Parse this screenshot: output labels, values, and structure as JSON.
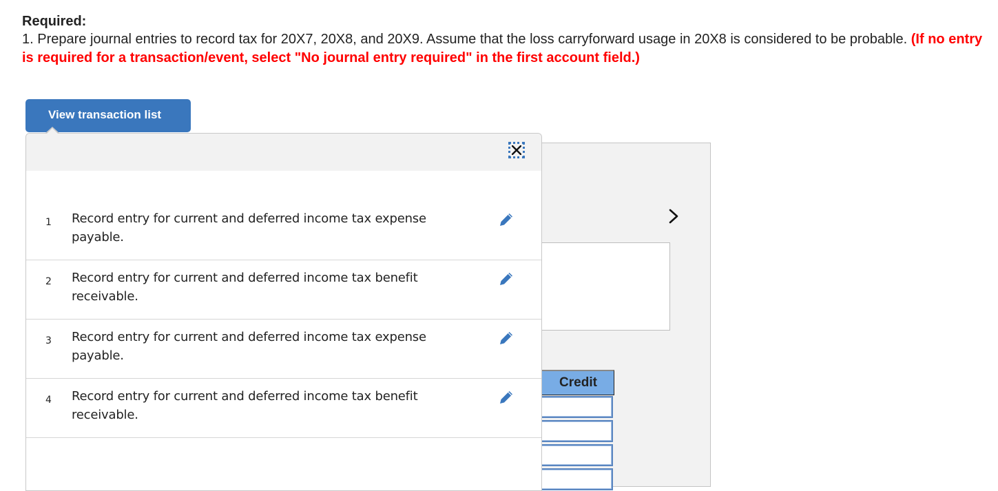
{
  "question": {
    "heading": "Required:",
    "instruction_text": "1. Prepare journal entries to record tax for 20X7, 20X8, and 20X9. Assume that the loss carryforward usage in 20X8 is considered to be probable. ",
    "instruction_note": "(If no entry is required for a transaction/event, select \"No journal entry required\" in the first account field.)"
  },
  "view_transaction_list_button": "View transaction list",
  "transaction_popover": {
    "close_icon": "close-icon",
    "edit_icon": "pencil-icon",
    "items": [
      {
        "number": "1",
        "description": "Record entry for current and deferred income tax expense payable."
      },
      {
        "number": "2",
        "description": "Record entry for current and deferred income tax benefit receivable."
      },
      {
        "number": "3",
        "description": "Record entry for current and deferred income tax expense payable."
      },
      {
        "number": "4",
        "description": "Record entry for current and deferred income tax benefit receivable."
      }
    ]
  },
  "worksheet": {
    "next_icon": "chevron-right-icon",
    "credit_header": "Credit",
    "credit_cells": [
      "",
      "",
      "",
      ""
    ]
  },
  "colors": {
    "accent": "#3a77bd",
    "warning_text": "#ff0000",
    "header_cell": "#78ace5",
    "panel_bg": "#f2f2f2"
  }
}
